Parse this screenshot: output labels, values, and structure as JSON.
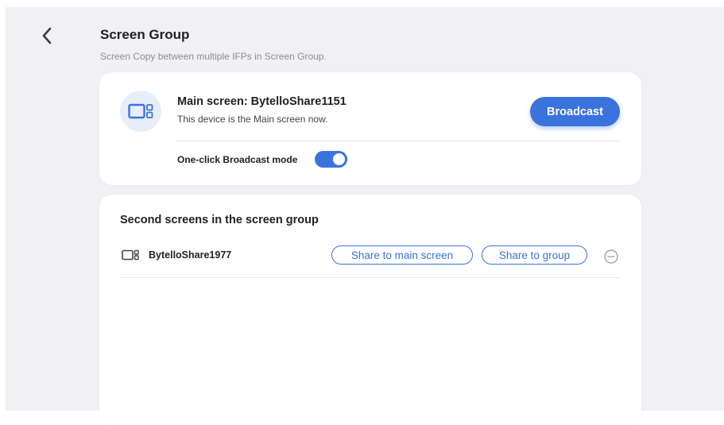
{
  "header": {
    "back_icon": "chevron-left-icon",
    "title": "Screen Group",
    "subtitle": "Screen Copy between multiple IFPs in Screen Group."
  },
  "main_screen": {
    "icon": "screen-group-device-icon",
    "name": "Main screen: BytelloShare1151",
    "note": "This device is the Main screen now.",
    "broadcast_label": "Broadcast",
    "broadcast_mode_label": "One-click Broadcast mode",
    "broadcast_mode_on": true
  },
  "second_screens": {
    "title": "Second screens in the screen group",
    "items": [
      {
        "icon": "screen-device-icon",
        "name": "BytelloShare1977",
        "share_main_label": "Share to main screen",
        "share_group_label": "Share to group",
        "remove_icon": "minus-circle-icon"
      }
    ]
  },
  "colors": {
    "accent": "#3b73de",
    "background": "#f1f1f3",
    "card": "#ffffff",
    "badge_bg": "#e8eef9"
  }
}
